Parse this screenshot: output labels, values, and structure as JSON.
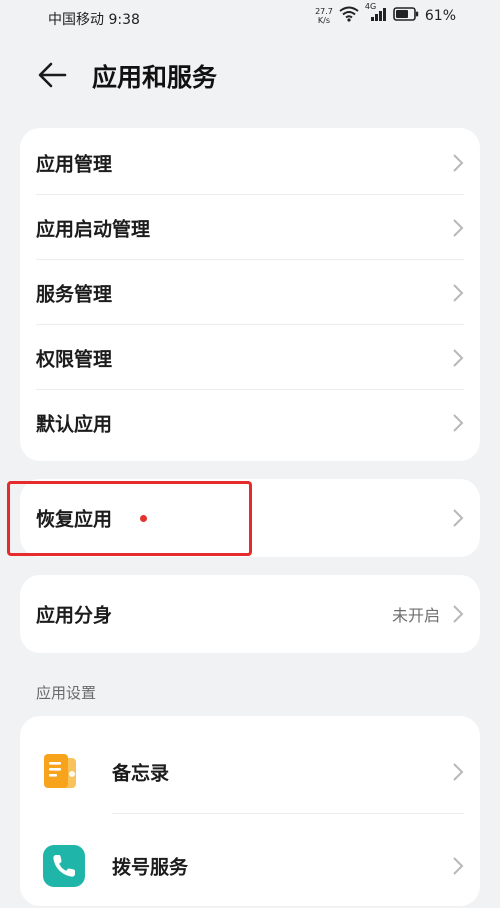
{
  "status_bar": {
    "carrier_time": "中国移动 9:38",
    "net_speed_value": "27.7",
    "net_speed_unit": "K/s",
    "signal_label": "4G",
    "battery": "61%"
  },
  "header": {
    "title": "应用和服务"
  },
  "main_group": {
    "items": [
      {
        "label": "应用管理"
      },
      {
        "label": "应用启动管理"
      },
      {
        "label": "服务管理"
      },
      {
        "label": "权限管理"
      },
      {
        "label": "默认应用"
      }
    ]
  },
  "restore_group": {
    "label": "恢复应用",
    "badge_color": "#e5322d"
  },
  "clone_group": {
    "label": "应用分身",
    "value": "未开启"
  },
  "app_settings": {
    "header": "应用设置",
    "items": [
      {
        "label": "备忘录",
        "icon": "notes-app-icon",
        "color": "#f7a31c"
      },
      {
        "label": "拨号服务",
        "icon": "phone-app-icon",
        "color": "#1fb6a9"
      }
    ]
  },
  "colors": {
    "background": "#f1f2f4",
    "card": "#ffffff",
    "highlight": "#e52b2b"
  }
}
